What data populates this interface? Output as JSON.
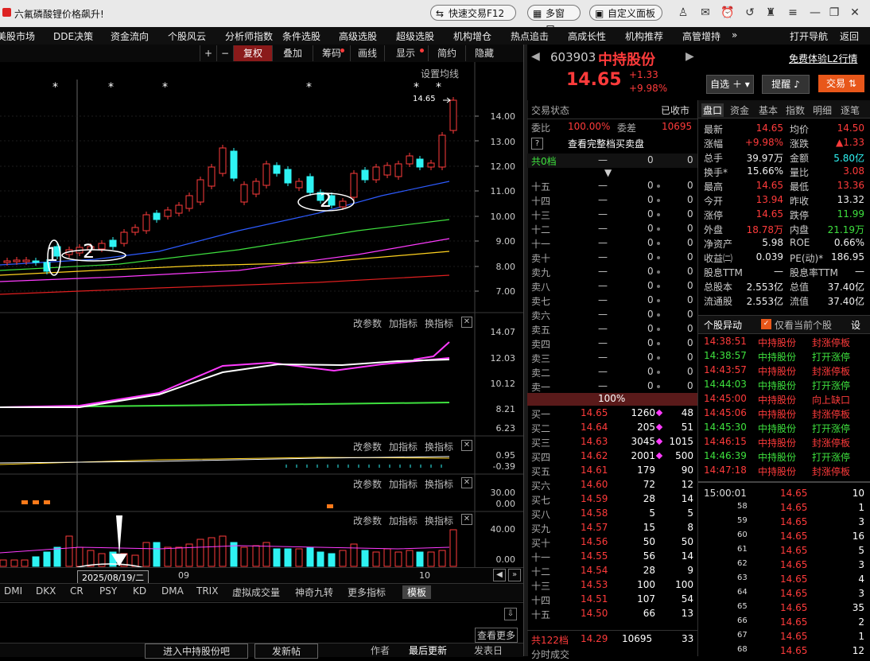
{
  "window": {
    "title": "六氟磷酸锂价格飙升!",
    "quick_trade": "快速交易F12",
    "multi_window": "多窗口",
    "custom_panel": "自定义面板"
  },
  "menu": {
    "items": [
      "美股市场",
      "DDE决策",
      "资金流向",
      "个股风云",
      "分析师指数",
      "条件选股",
      "高级选股",
      "超级选股",
      "机构增仓",
      "热点追击",
      "高成长性",
      "机构推荐",
      "高管增持"
    ],
    "more": "»",
    "open_nav": "打开导航",
    "back": "返回"
  },
  "chart_toolbar": {
    "plus": "+",
    "minus": "−",
    "fuquan": "复权",
    "overlay": "叠加",
    "chips": "筹码",
    "draw": "画线",
    "display": "显示",
    "simple": "简约",
    "hide": "隐藏"
  },
  "chart_labels": {
    "ma_setting": "设置均线",
    "price_tag": "14.65",
    "annot_1": "1",
    "annot_2a": "2",
    "annot_2b": "2",
    "date_box": "2025/08/19/二",
    "month_09": "09",
    "month_10": "10"
  },
  "price_axis": [
    "14.00",
    "13.00",
    "12.00",
    "11.00",
    "10.00",
    "9.00",
    "8.00",
    "7.00"
  ],
  "panel_buttons": {
    "change_params": "改参数",
    "add_indicator": "加指标",
    "switch_indicator": "换指标"
  },
  "panel1_axis": [
    "14.07",
    "12.03",
    "10.12",
    "8.21",
    "6.23"
  ],
  "panel2_axis": [
    "0.95",
    "-0.39"
  ],
  "panel3_axis": [
    "30.00",
    "0.00"
  ],
  "panel4_axis": [
    "40.00",
    "0.00"
  ],
  "indicator_tabs": [
    "DMI",
    "DKX",
    "CR",
    "PSY",
    "KD",
    "DMA",
    "TRIX",
    "虚拟成交量",
    "神奇九转",
    "更多指标",
    "模板"
  ],
  "bottom_bar": {
    "view_more": "查看更多",
    "enter_forum": "进入中持股份吧",
    "post": "发新帖",
    "author": "作者",
    "last_update": "最后更新",
    "post_date": "发表日"
  },
  "stock": {
    "code": "603903",
    "name": "中持股份",
    "price": "14.65",
    "change": "+1.33",
    "change_pct": "+9.98%",
    "l2": "免费体验L2行情",
    "watchlist": "自选",
    "alert": "提醒",
    "trade": "交易"
  },
  "trade_status": {
    "label": "交易状态",
    "value": "已收市"
  },
  "weibi": {
    "label1": "委比",
    "v1": "100.00%",
    "label2": "委差",
    "v2": "10695"
  },
  "full_book": "查看完整档买卖盘",
  "sell_total": {
    "label": "共0档",
    "a": "—",
    "b": "0",
    "c": "0"
  },
  "sells": [
    {
      "label": "十五",
      "p": "—",
      "v": "0",
      "c": "0"
    },
    {
      "label": "十四",
      "p": "—",
      "v": "0",
      "c": "0"
    },
    {
      "label": "十三",
      "p": "—",
      "v": "0",
      "c": "0"
    },
    {
      "label": "十二",
      "p": "—",
      "v": "0",
      "c": "0"
    },
    {
      "label": "十一",
      "p": "—",
      "v": "0",
      "c": "0"
    },
    {
      "label": "卖十",
      "p": "—",
      "v": "0",
      "c": "0"
    },
    {
      "label": "卖九",
      "p": "—",
      "v": "0",
      "c": "0"
    },
    {
      "label": "卖八",
      "p": "—",
      "v": "0",
      "c": "0"
    },
    {
      "label": "卖七",
      "p": "—",
      "v": "0",
      "c": "0"
    },
    {
      "label": "卖六",
      "p": "—",
      "v": "0",
      "c": "0"
    },
    {
      "label": "卖五",
      "p": "—",
      "v": "0",
      "c": "0"
    },
    {
      "label": "卖四",
      "p": "—",
      "v": "0",
      "c": "0"
    },
    {
      "label": "卖三",
      "p": "—",
      "v": "0",
      "c": "0"
    },
    {
      "label": "卖二",
      "p": "—",
      "v": "0",
      "c": "0"
    },
    {
      "label": "卖一",
      "p": "—",
      "v": "0",
      "c": "0"
    }
  ],
  "book_pct": "100%",
  "buys": [
    {
      "label": "买一",
      "p": "14.65",
      "v": "1260",
      "c": "48"
    },
    {
      "label": "买二",
      "p": "14.64",
      "v": "205",
      "c": "51"
    },
    {
      "label": "买三",
      "p": "14.63",
      "v": "3045",
      "c": "1015"
    },
    {
      "label": "买四",
      "p": "14.62",
      "v": "2001",
      "c": "500"
    },
    {
      "label": "买五",
      "p": "14.61",
      "v": "179",
      "c": "90"
    },
    {
      "label": "买六",
      "p": "14.60",
      "v": "72",
      "c": "12"
    },
    {
      "label": "买七",
      "p": "14.59",
      "v": "28",
      "c": "14"
    },
    {
      "label": "买八",
      "p": "14.58",
      "v": "5",
      "c": "5"
    },
    {
      "label": "买九",
      "p": "14.57",
      "v": "15",
      "c": "8"
    },
    {
      "label": "买十",
      "p": "14.56",
      "v": "50",
      "c": "50"
    },
    {
      "label": "十一",
      "p": "14.55",
      "v": "56",
      "c": "14"
    },
    {
      "label": "十二",
      "p": "14.54",
      "v": "28",
      "c": "9"
    },
    {
      "label": "十三",
      "p": "14.53",
      "v": "100",
      "c": "100"
    },
    {
      "label": "十四",
      "p": "14.51",
      "v": "107",
      "c": "54"
    },
    {
      "label": "十五",
      "p": "14.50",
      "v": "66",
      "c": "13"
    }
  ],
  "buy_total": {
    "label": "共122档",
    "p": "14.29",
    "v": "10695",
    "c": "33"
  },
  "time_sales_label": "分时成交",
  "tabs_right": [
    "盘口",
    "资金",
    "基本",
    "指数",
    "明细",
    "逐笔"
  ],
  "quote": [
    {
      "k1": "最新",
      "v1": "14.65",
      "c1": "red",
      "k2": "均价",
      "v2": "14.50",
      "c2": "red"
    },
    {
      "k1": "涨幅",
      "v1": "+9.98%",
      "c1": "red",
      "k2": "涨跌",
      "v2": "▲1.33",
      "c2": "red"
    },
    {
      "k1": "总手",
      "v1": "39.97万",
      "c1": "white",
      "k2": "金额",
      "v2": "5.80亿",
      "c2": "cyan"
    },
    {
      "k1": "换手*",
      "v1": "15.66%",
      "c1": "white",
      "k2": "量比",
      "v2": "3.08",
      "c2": "red"
    },
    {
      "k1": "最高",
      "v1": "14.65",
      "c1": "red",
      "k2": "最低",
      "v2": "13.36",
      "c2": "red"
    },
    {
      "k1": "今开",
      "v1": "13.94",
      "c1": "red",
      "k2": "昨收",
      "v2": "13.32",
      "c2": "white"
    },
    {
      "k1": "涨停",
      "v1": "14.65",
      "c1": "red",
      "k2": "跌停",
      "v2": "11.99",
      "c2": "green"
    },
    {
      "k1": "外盘",
      "v1": "18.78万",
      "c1": "red",
      "k2": "内盘",
      "v2": "21.19万",
      "c2": "green"
    },
    {
      "k1": "净资产",
      "v1": "5.98",
      "c1": "white",
      "k2": "ROE",
      "v2": "0.66%",
      "c2": "white"
    },
    {
      "k1": "收益㈡",
      "v1": "0.039",
      "c1": "white",
      "k2": "PE(动)*",
      "v2": "186.95",
      "c2": "white"
    },
    {
      "k1": "股息TTM",
      "v1": "—",
      "c1": "white",
      "k2": "股息率TTM",
      "v2": "—",
      "c2": "white"
    },
    {
      "k1": "总股本",
      "v1": "2.553亿",
      "c1": "white",
      "k2": "总值",
      "v2": "37.40亿",
      "c2": "white"
    },
    {
      "k1": "流通股",
      "v1": "2.553亿",
      "c1": "white",
      "k2": "流值",
      "v2": "37.40亿",
      "c2": "white"
    }
  ],
  "anomaly": {
    "title": "个股异动",
    "only_current": "仅看当前个股",
    "settings": "设"
  },
  "anomalies": [
    {
      "t": "14:38:51",
      "n": "中持股份",
      "e": "封涨停板",
      "c": "red"
    },
    {
      "t": "14:38:57",
      "n": "中持股份",
      "e": "打开涨停",
      "c": "green"
    },
    {
      "t": "14:43:57",
      "n": "中持股份",
      "e": "封涨停板",
      "c": "red"
    },
    {
      "t": "14:44:03",
      "n": "中持股份",
      "e": "打开涨停",
      "c": "green"
    },
    {
      "t": "14:45:00",
      "n": "中持股份",
      "e": "向上缺口",
      "c": "red"
    },
    {
      "t": "14:45:06",
      "n": "中持股份",
      "e": "封涨停板",
      "c": "red"
    },
    {
      "t": "14:45:30",
      "n": "中持股份",
      "e": "打开涨停",
      "c": "green"
    },
    {
      "t": "14:46:15",
      "n": "中持股份",
      "e": "封涨停板",
      "c": "red"
    },
    {
      "t": "14:46:39",
      "n": "中持股份",
      "e": "打开涨停",
      "c": "green"
    },
    {
      "t": "14:47:18",
      "n": "中持股份",
      "e": "封涨停板",
      "c": "red"
    }
  ],
  "ticks": [
    {
      "t": "15:00:01",
      "p": "14.65",
      "v": "10"
    },
    {
      "t": "58",
      "p": "14.65",
      "v": "1"
    },
    {
      "t": "59",
      "p": "14.65",
      "v": "3"
    },
    {
      "t": "60",
      "p": "14.65",
      "v": "16"
    },
    {
      "t": "61",
      "p": "14.65",
      "v": "5"
    },
    {
      "t": "62",
      "p": "14.65",
      "v": "3"
    },
    {
      "t": "63",
      "p": "14.65",
      "v": "4"
    },
    {
      "t": "64",
      "p": "14.65",
      "v": "3"
    },
    {
      "t": "65",
      "p": "14.65",
      "v": "35"
    },
    {
      "t": "66",
      "p": "14.65",
      "v": "2"
    },
    {
      "t": "67",
      "p": "14.65",
      "v": "1"
    },
    {
      "t": "68",
      "p": "14.65",
      "v": "12"
    }
  ],
  "colors": {
    "up": "#ff3b3b",
    "down": "#2ef3f3",
    "ma5": "#ffffff",
    "ma10": "#ffd21f",
    "ma20": "#ff3bff",
    "ma60": "#3ee03e",
    "ma120": "#2d5bff",
    "ma250": "#e01f1f"
  }
}
